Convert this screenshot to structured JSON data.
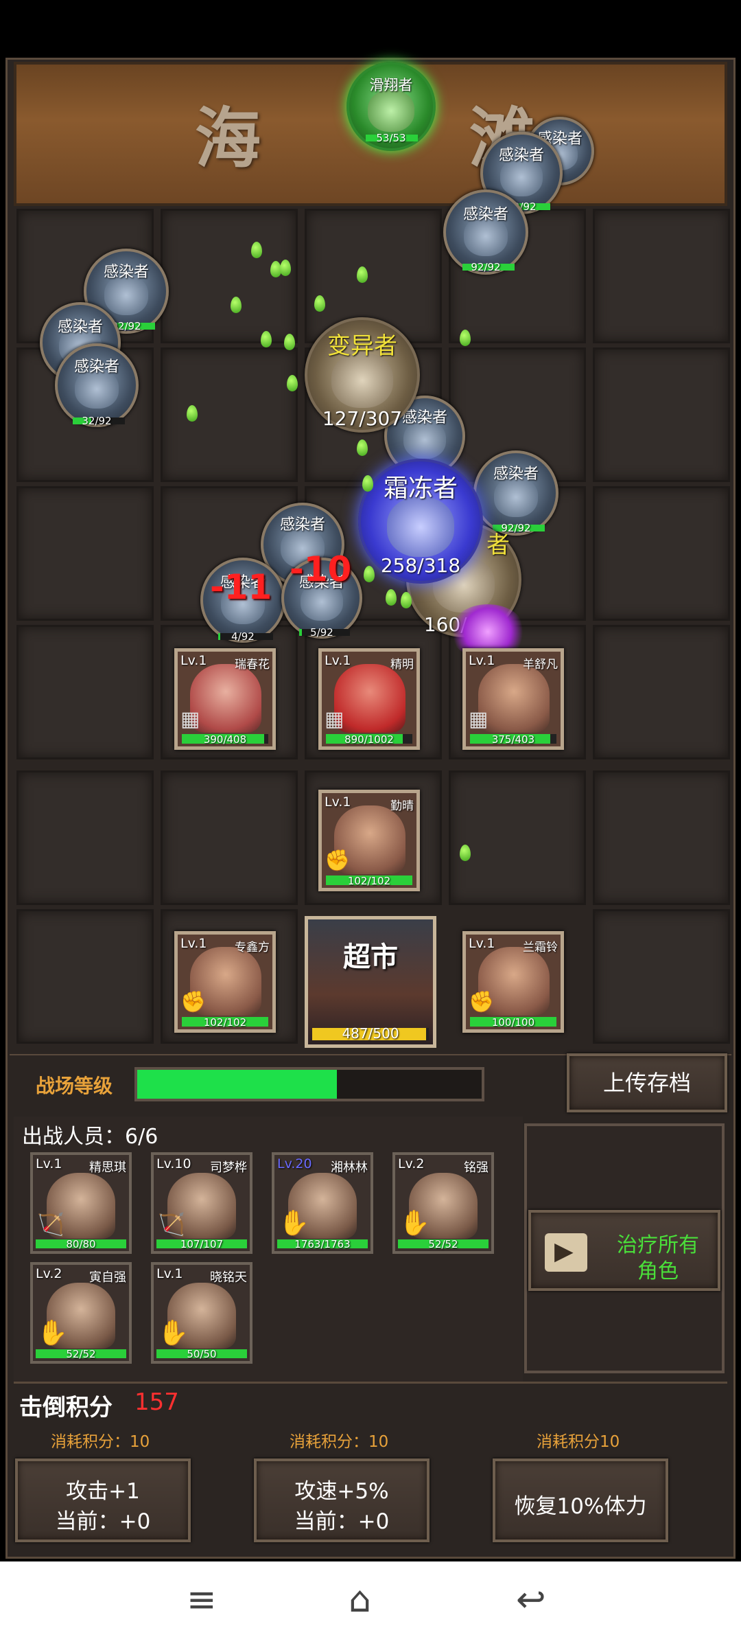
{
  "map": {
    "title_chars": [
      "海",
      "滩"
    ]
  },
  "boss_top": {
    "name": "滑翔者",
    "hp": "53/53"
  },
  "enemies": [
    {
      "name": "感染者",
      "hp": "92/92"
    },
    {
      "name": "感染者",
      "hp": "92/92"
    },
    {
      "name": "感染者",
      "hp": "92/92"
    },
    {
      "name": "感染者",
      "hp": "92/92"
    },
    {
      "name": "感染者",
      "hp": "92/92"
    },
    {
      "name": "感染者",
      "hp": "92/92"
    },
    {
      "name": "感染者",
      "hp": "92/92"
    },
    {
      "name": "感染者",
      "hp": "32/92"
    },
    {
      "name": "感染者",
      "hp": "92/92"
    },
    {
      "name": "感染者",
      "hp": "92/92"
    },
    {
      "name": "感染者",
      "hp": "4/92"
    },
    {
      "name": "感染者",
      "hp": "5/92"
    }
  ],
  "mutant": {
    "name": "变异者",
    "hp": "127/307"
  },
  "mutant2": {
    "name": "者",
    "hp": "160/307"
  },
  "frost": {
    "name": "霜冻者",
    "hp": "258/318"
  },
  "damage_numbers": [
    "-11",
    "-10"
  ],
  "heroes": [
    {
      "level": "Lv.1",
      "name": "瑞春花",
      "hp": "390/408",
      "hp_fraction": 0.956
    },
    {
      "level": "Lv.1",
      "name": "精明",
      "hp": "890/1002",
      "hp_fraction": 0.888
    },
    {
      "level": "Lv.1",
      "name": "羊舒凡",
      "hp": "375/403",
      "hp_fraction": 0.93
    },
    {
      "level": "Lv.1",
      "name": "勤晴",
      "hp": "102/102",
      "hp_fraction": 1.0
    },
    {
      "level": "Lv.1",
      "name": "专鑫方",
      "hp": "102/102",
      "hp_fraction": 1.0
    },
    {
      "level": "Lv.1",
      "name": "兰霜铃",
      "hp": "100/100",
      "hp_fraction": 1.0
    }
  ],
  "base": {
    "label": "超市",
    "hp": "487/500",
    "hp_fraction": 0.974
  },
  "battle_level": {
    "label": "战场等级",
    "progress": 0.58
  },
  "upload_button": "上传存档",
  "roster": {
    "header": "出战人员：6/6",
    "members": [
      {
        "level": "Lv.1",
        "name": "精思琪",
        "hp": "80/80"
      },
      {
        "level": "Lv.10",
        "name": "司梦桦",
        "hp": "107/107"
      },
      {
        "level": "Lv.20",
        "name": "湘林林",
        "hp": "1763/1763"
      },
      {
        "level": "Lv.2",
        "name": "铭强",
        "hp": "52/52"
      },
      {
        "level": "Lv.2",
        "name": "寅自强",
        "hp": "52/52"
      },
      {
        "level": "Lv.1",
        "name": "晓铭天",
        "hp": "50/50"
      }
    ]
  },
  "heal_button": {
    "line1": "治疗所有",
    "line2": "角色"
  },
  "score": {
    "label": "击倒积分",
    "value": "157"
  },
  "upgrades": [
    {
      "cost": "消耗积分：10",
      "line1": "攻击+1",
      "line2": "当前：+0"
    },
    {
      "cost": "消耗积分：10",
      "line1": "攻速+5%",
      "line2": "当前：+0"
    },
    {
      "cost": "消耗积分10",
      "line1": "恢复10%体力",
      "line2": ""
    }
  ],
  "colors": {
    "hp_green": "#2ad03a",
    "damage_red": "#ff2020",
    "score_red": "#ff3030",
    "gold_text": "#e8a23a",
    "heal_text": "#4adf3a"
  }
}
